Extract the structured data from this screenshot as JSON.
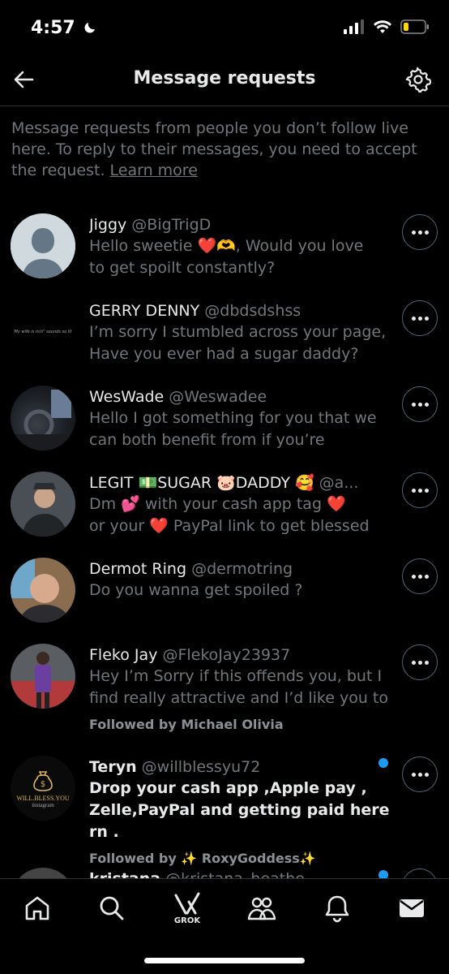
{
  "status": {
    "time": "4:57"
  },
  "header": {
    "title": "Message requests"
  },
  "intro": {
    "text": "Message requests from people you don’t follow live here. To reply to their messages, you need to accept the request.",
    "link": "Learn more"
  },
  "conversations": [
    {
      "name": "Jiggy",
      "handle": "@BigTrigD",
      "line1": "Hello sweetie ❤️🫶, Would you love",
      "line2": "to get spoilt constantly?",
      "followed": "",
      "unread": false
    },
    {
      "name": "GERRY DENNY",
      "handle": "@dbdsdshss",
      "line1": "I’m sorry I stumbled across your page,",
      "line2": "Have you ever had a sugar daddy?",
      "followed": "",
      "unread": false,
      "avatar_text": "My wife is rich\" sounds so lit"
    },
    {
      "name": "WesWade",
      "handle": "@Weswadee",
      "line1": "Hello I got something for you that we",
      "line2": "can both benefit from if you’re",
      "followed": "",
      "unread": false
    },
    {
      "name": "LEGIT 💵SUGAR 🐷DADDY 🥰",
      "handle": "@a...",
      "line1": "Dm 💕 with your cash app tag ❤️",
      "line2": "or your ❤️ PayPal link to get blessed",
      "followed": "",
      "unread": false
    },
    {
      "name": "Dermot Ring",
      "handle": "@dermotring",
      "line1": "Do you wanna get spoiled ?",
      "line2": "",
      "followed": "",
      "unread": false
    },
    {
      "name": "Fleko Jay",
      "handle": "@FlekoJay23937",
      "line1": "Hey I’m Sorry if this offends you, but I",
      "line2": "find really attractive and I’d like you to",
      "followed": "Followed by Michael Olivia",
      "unread": false
    },
    {
      "name": "Teryn",
      "handle": "@willblessyu72",
      "line1": "Drop your cash app ,Apple pay ,",
      "line2": "Zelle,PayPal and getting paid here rn .",
      "followed": "Followed by ✨ RoxyGoddess✨",
      "unread": true,
      "avatar_text": "WILL.BLESS.YOU",
      "avatar_sub": "instagram"
    },
    {
      "name": "kristana",
      "handle": "@kristana_heathe",
      "line1": "",
      "line2": "",
      "followed": "",
      "unread": true
    }
  ],
  "nav": {
    "grok_label": "GROK"
  },
  "colors": {
    "accent": "#1d9bf0",
    "background": "#000000",
    "muted": "#71767b"
  }
}
